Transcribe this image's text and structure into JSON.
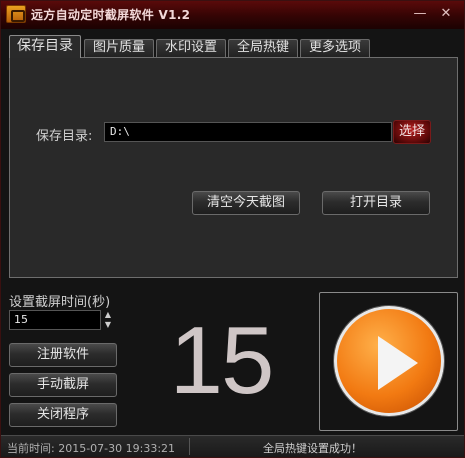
{
  "window": {
    "title": "远方自动定时截屏软件 V1.2"
  },
  "titlebar_buttons": {
    "minimize_icon": "minimize-icon",
    "close_icon": "close-icon",
    "minimize_glyph": "—",
    "close_glyph": "✕"
  },
  "tabs": [
    {
      "label": "保存目录",
      "active": true
    },
    {
      "label": "图片质量",
      "active": false
    },
    {
      "label": "水印设置",
      "active": false
    },
    {
      "label": "全局热键",
      "active": false
    },
    {
      "label": "更多选项",
      "active": false
    }
  ],
  "save_dir": {
    "label": "保存目录:",
    "value": "D:\\",
    "choose_label": "选择"
  },
  "actions": {
    "clear_today_label": "清空今天截图",
    "open_dir_label": "打开目录"
  },
  "interval": {
    "label": "设置截屏时间(秒)",
    "value": "15"
  },
  "side_buttons": {
    "register_label": "注册软件",
    "manual_label": "手动截屏",
    "close_label": "关闭程序"
  },
  "countdown": "15",
  "play": {
    "icon": "play-icon",
    "accent": "#f27a12"
  },
  "status": {
    "time": "当前时间: 2015-07-30 19:33:21",
    "message": "全局热键设置成功！"
  }
}
